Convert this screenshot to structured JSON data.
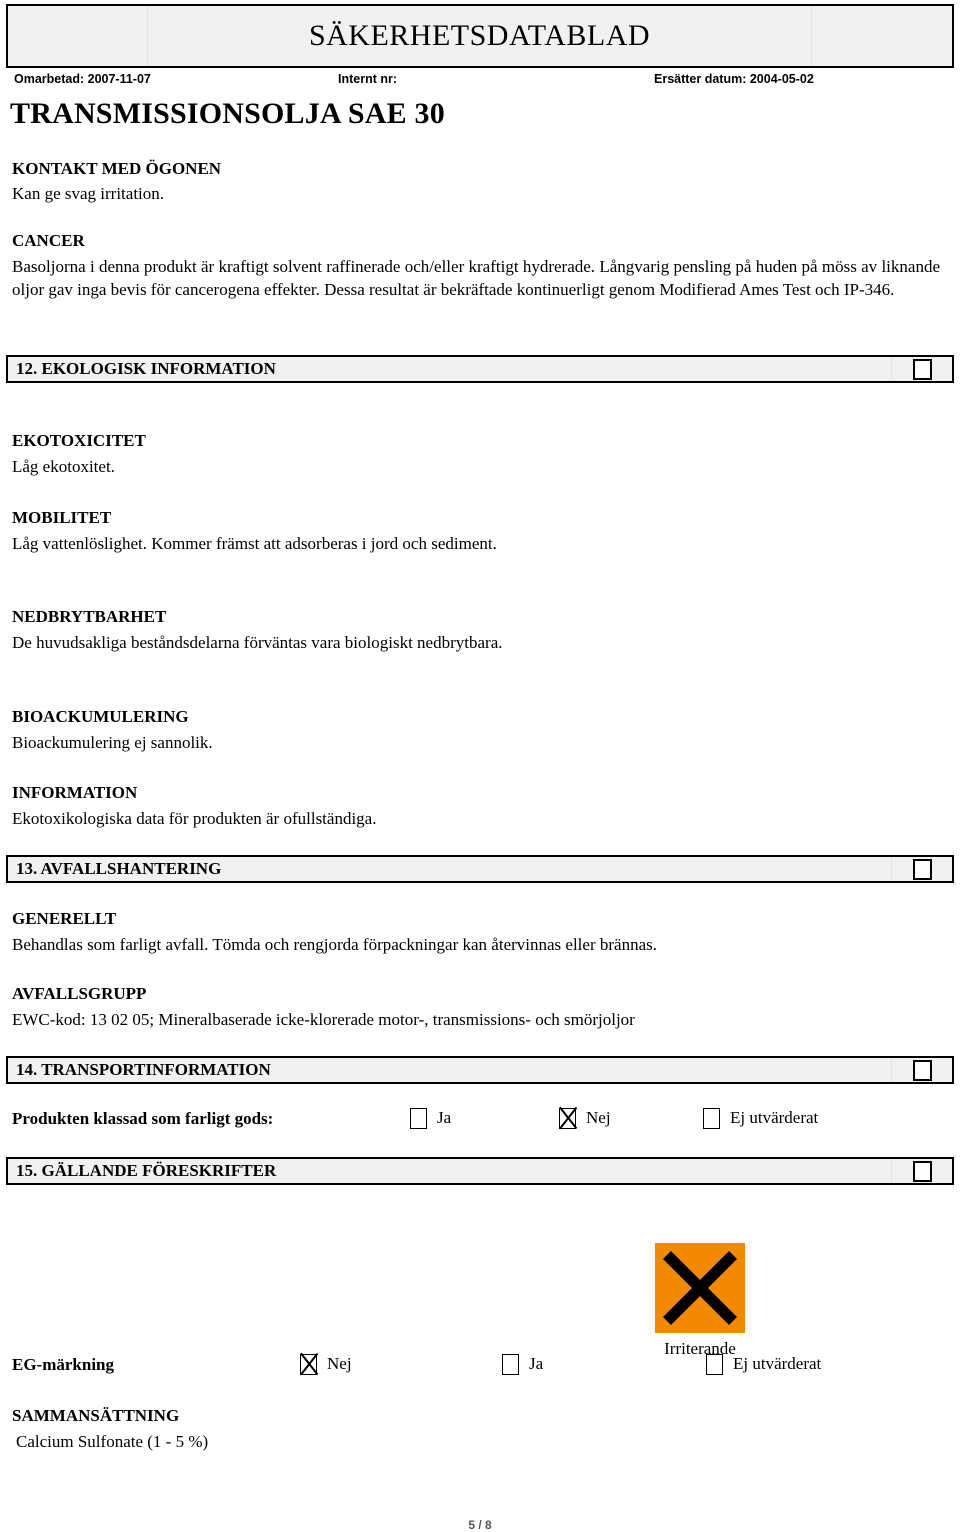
{
  "banner": {
    "title": "SÄKERHETSDATABLAD"
  },
  "meta": {
    "revised": "Omarbetad: 2007-11-07",
    "internal_no": "Internt nr:",
    "replaces": "Ersätter datum: 2004-05-02"
  },
  "product": {
    "title": "TRANSMISSIONSOLJA SAE 30"
  },
  "eye_contact": {
    "heading": "KONTAKT MED ÖGONEN",
    "text": "Kan ge svag irritation."
  },
  "cancer": {
    "heading": "CANCER",
    "text": "Basoljorna i denna produkt är kraftigt solvent raffinerade och/eller kraftigt hydrerade. Långvarig pensling på huden på möss av liknande oljor gav inga bevis för cancerogena effekter. Dessa resultat är bekräftade kontinuerligt genom Modifierad Ames Test och IP-346."
  },
  "section12": {
    "title": "12. EKOLOGISK INFORMATION",
    "subsections": [
      {
        "heading": "EKOTOXICITET",
        "text": "Låg ekotoxitet."
      },
      {
        "heading": "MOBILITET",
        "text": "Låg vattenlöslighet. Kommer främst att adsorberas i jord och sediment."
      },
      {
        "heading": "NEDBRYTBARHET",
        "text": "De huvudsakliga beståndsdelarna förväntas vara biologiskt nedbrytbara."
      },
      {
        "heading": "BIOACKUMULERING",
        "text": "Bioackumulering ej sannolik."
      },
      {
        "heading": "INFORMATION",
        "text": "Ekotoxikologiska data för produkten är ofullständiga."
      }
    ]
  },
  "section13": {
    "title": "13. AVFALLSHANTERING",
    "subsections": [
      {
        "heading": "GENERELLT",
        "text": "Behandlas som farligt avfall.  Tömda och rengjorda förpackningar kan återvinnas eller brännas."
      },
      {
        "heading": "AVFALLSGRUPP",
        "text": "EWC-kod: 13 02 05; Mineralbaserade icke-klorerade motor-, transmissions- och smörjoljor"
      }
    ]
  },
  "section14": {
    "title": "14. TRANSPORTINFORMATION",
    "dangerous_goods": {
      "label": "Produkten klassad som farligt gods:",
      "options": [
        {
          "text": "Ja",
          "checked": false
        },
        {
          "text": "Nej",
          "checked": true
        },
        {
          "text": "Ej utvärderat",
          "checked": false
        }
      ]
    }
  },
  "section15": {
    "title": "15. GÄLLANDE FÖRESKRIFTER",
    "pictogram": {
      "symbol_name": "irritant-x-symbol",
      "label": "Irriterande",
      "background_color": "#F18A00",
      "mark_color": "#000000"
    },
    "eg_marking": {
      "label": "EG-märkning",
      "options": [
        {
          "text": "Nej",
          "checked": true
        },
        {
          "text": "Ja",
          "checked": false
        },
        {
          "text": "Ej utvärderat",
          "checked": false
        }
      ]
    },
    "composition": {
      "heading": "SAMMANSÄTTNING",
      "text": "Calcium Sulfonate (1 - 5 %)"
    }
  },
  "footer": {
    "page": "5 / 8"
  }
}
